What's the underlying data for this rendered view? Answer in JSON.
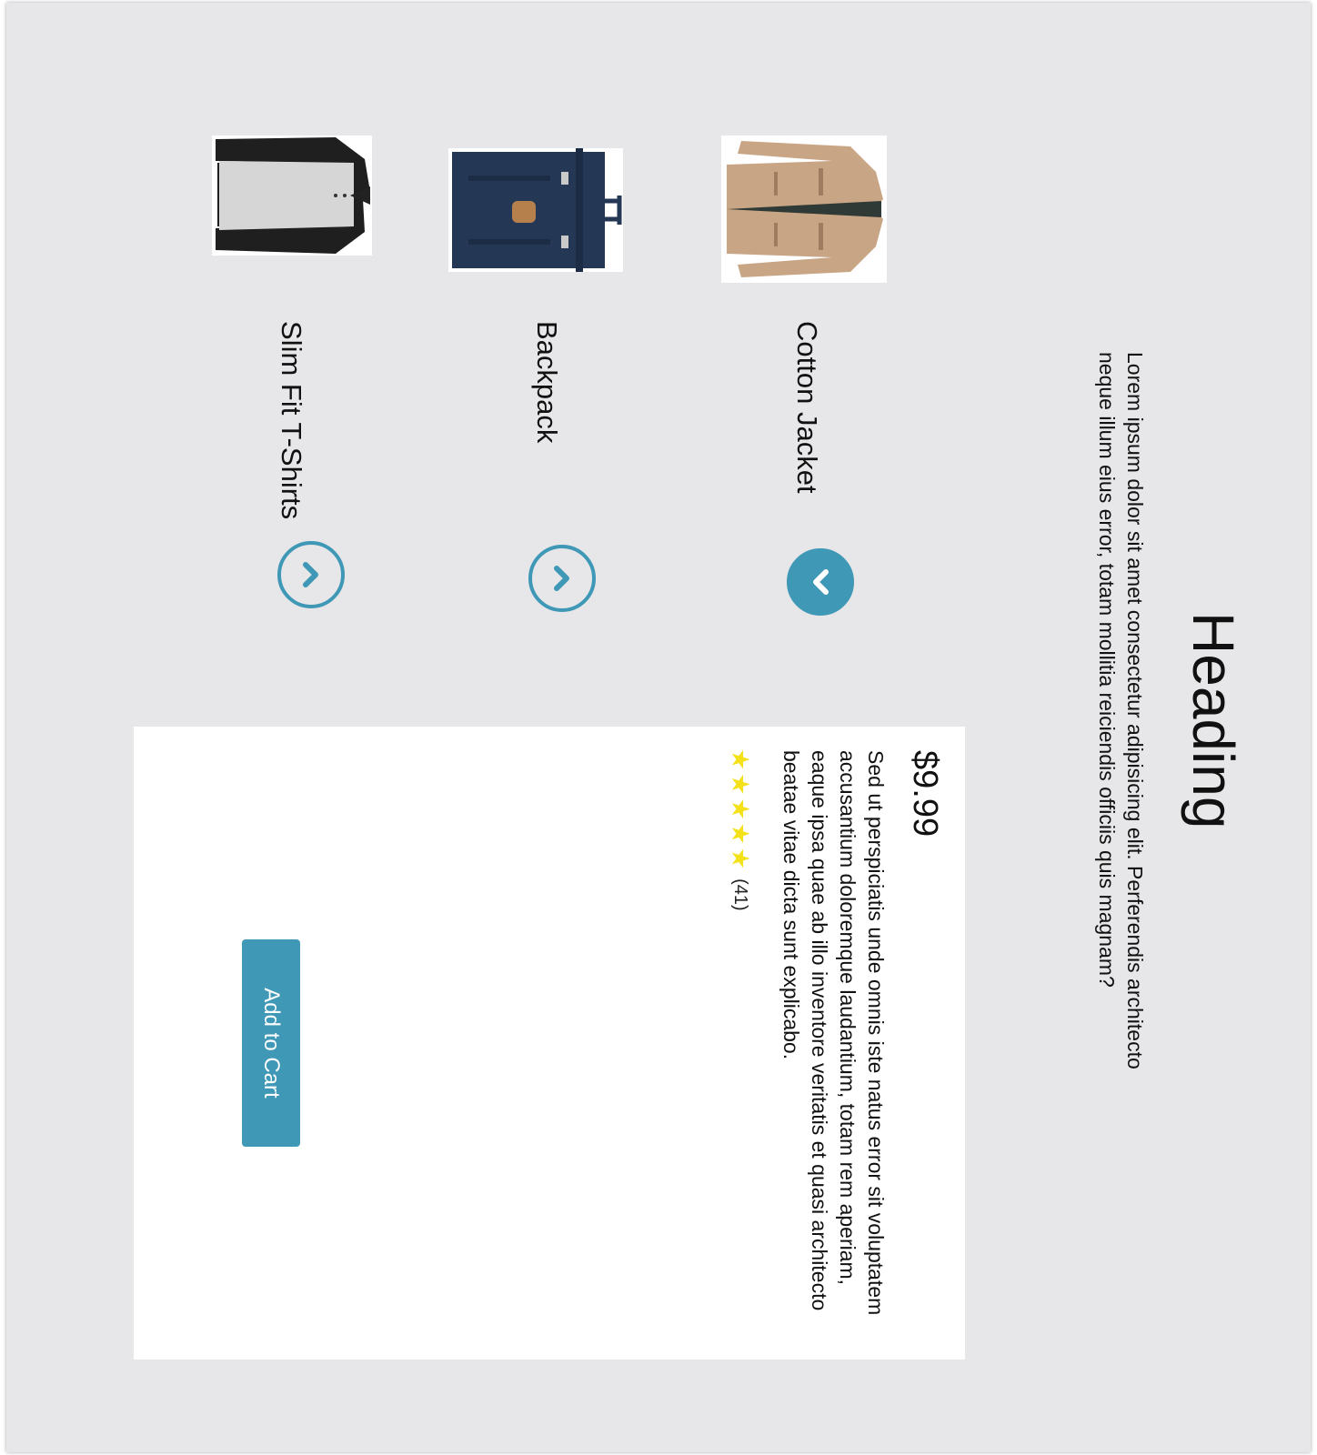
{
  "header": {
    "title": "Heading",
    "intro": "Lorem ipsum dolor sit amet consectetur adipisicing elit. Perferendis architecto neque illum eius error, totam mollitia reiciendis officiis quis magnam?"
  },
  "products": [
    {
      "name": "Cotton Jacket",
      "icon": "jacket-image",
      "expanded": true
    },
    {
      "name": "Backpack",
      "icon": "backpack-image",
      "expanded": false
    },
    {
      "name": "Slim Fit T-Shirts",
      "icon": "tshirt-image",
      "expanded": false
    }
  ],
  "detail": {
    "price": "$9.99",
    "description": "Sed ut perspiciatis unde omnis iste natus error sit voluptatem accusantium doloremque laudantium, totam rem aperiam, eaque ipsa quae ab illo inventore veritatis et quasi architecto beatae vitae dicta sunt explicabo.",
    "stars": 5,
    "reviews": "(41)",
    "add_to_cart_label": "Add to Cart"
  },
  "colors": {
    "accent": "#3e98b6",
    "star": "#f5e11a",
    "background": "#e7e6e8"
  }
}
